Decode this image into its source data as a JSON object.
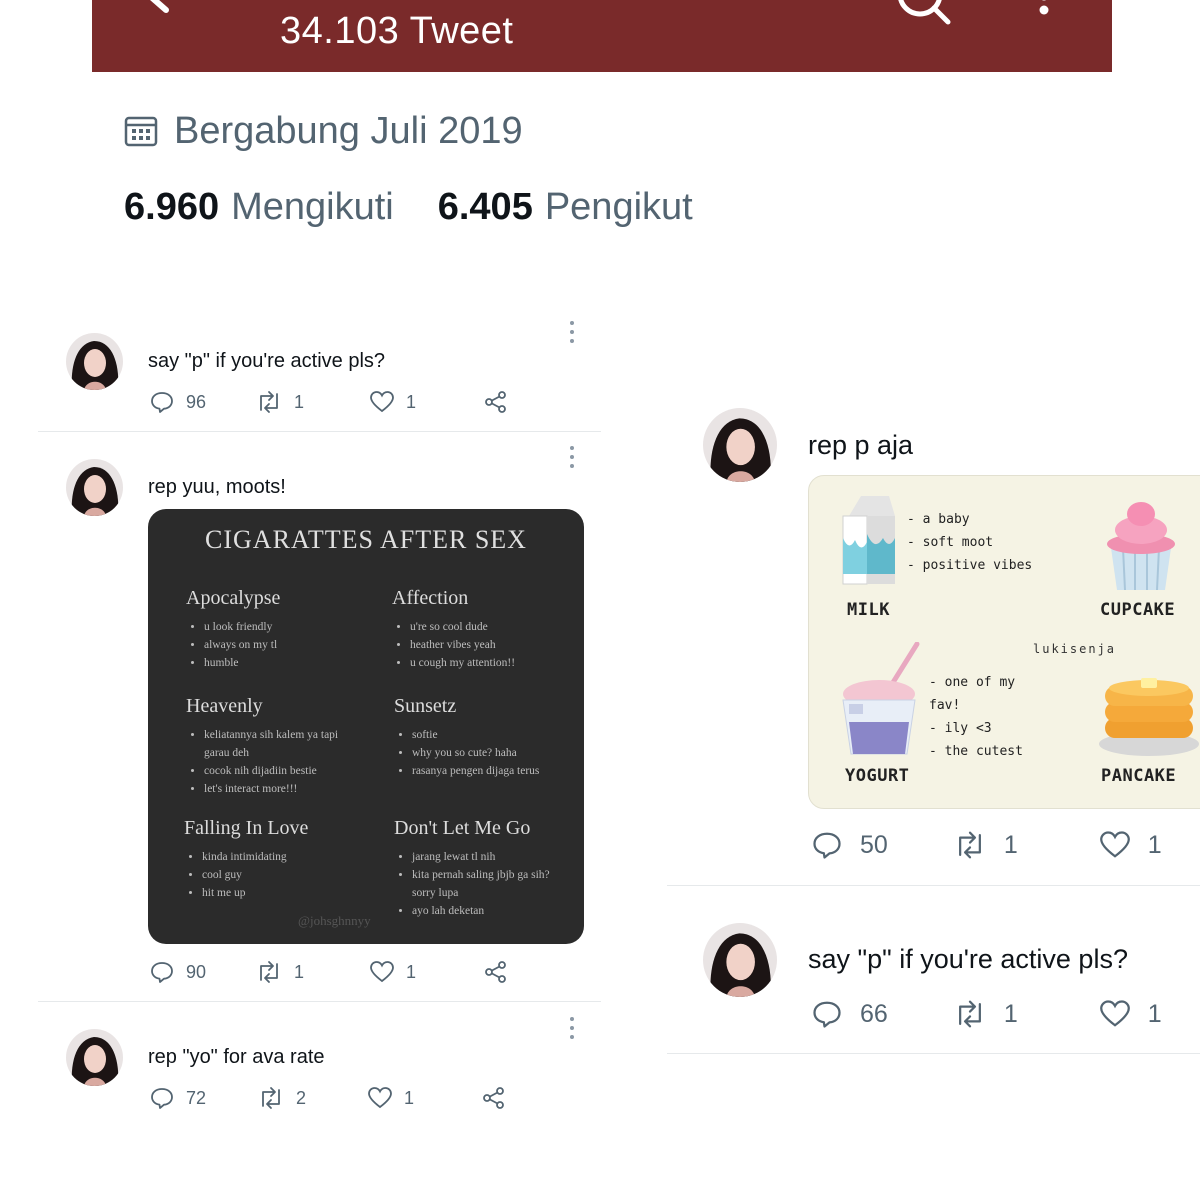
{
  "header": {
    "tweet_count": "34.103 Tweet",
    "bar_color": "#7a2a2a"
  },
  "profile": {
    "joined": "Bergabung Juli 2019",
    "following_count": "6.960",
    "following_label": "Mengikuti",
    "followers_count": "6.405",
    "followers_label": "Pengikut"
  },
  "left_tweets": [
    {
      "text": "say \"p\" if you're active pls?",
      "replies": "96",
      "retweets": "1",
      "likes": "1"
    },
    {
      "text": "rep yuu, moots!",
      "replies": "90",
      "retweets": "1",
      "likes": "1"
    },
    {
      "text": "rep \"yo\" for ava rate",
      "replies": "72",
      "retweets": "2",
      "likes": "1"
    }
  ],
  "right_tweets": [
    {
      "text": "rep p aja",
      "replies": "50",
      "retweets": "1",
      "likes": "1"
    },
    {
      "text": "say \"p\" if you're active pls?",
      "replies": "66",
      "retweets": "1",
      "likes": "1"
    }
  ],
  "cas_card": {
    "title": "CIGARATTES AFTER SEX",
    "watermark": "@johsghnnyy",
    "sections": [
      {
        "heading": "Apocalypse",
        "items": [
          "u look friendly",
          "always on my tl",
          "humble"
        ]
      },
      {
        "heading": "Affection",
        "items": [
          "u're so cool dude",
          "heather vibes yeah",
          "u cough my attention!!"
        ]
      },
      {
        "heading": "Heavenly",
        "items": [
          "keliatannya sih kalem ya tapi garau deh",
          "cocok nih dijadiin bestie",
          "let's interact more!!!"
        ]
      },
      {
        "heading": "Sunsetz",
        "items": [
          "softie",
          "why you so cute? haha",
          "rasanya pengen dijaga terus"
        ]
      },
      {
        "heading": "Falling In Love",
        "items": [
          "kinda intimidating",
          "cool guy",
          "hit me up"
        ]
      },
      {
        "heading": "Don't Let Me Go",
        "items": [
          "jarang lewat tl nih",
          "kita pernah saling jbjb ga sih? sorry lupa",
          "ayo lah deketan"
        ]
      }
    ]
  },
  "food_card": {
    "brand": "lukisenja",
    "milk_label": "MILK",
    "milk_notes": [
      "- a baby",
      "- soft moot",
      "- positive vibes"
    ],
    "cupcake_label": "CUPCAKE",
    "yogurt_label": "YOGURT",
    "yogurt_notes": [
      "- one of my",
      "fav!",
      "- ily <3",
      "- the cutest"
    ],
    "pancake_label": "PANCAKE"
  }
}
